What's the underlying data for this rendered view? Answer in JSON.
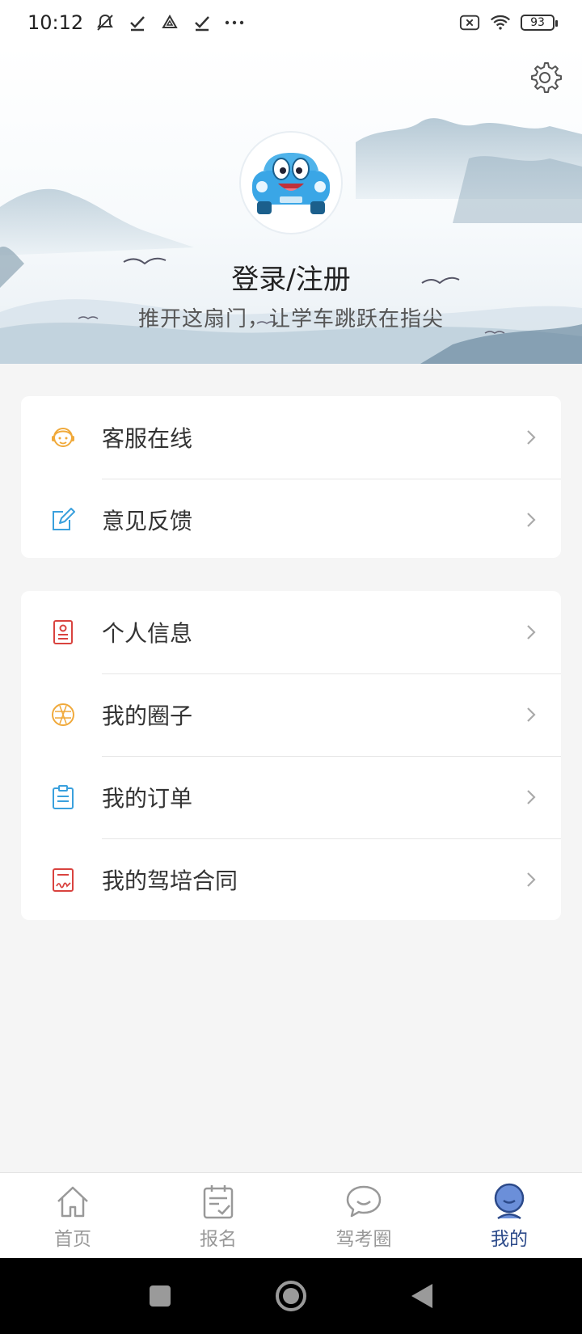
{
  "status_bar": {
    "time": "10:12",
    "battery": "93",
    "icons": [
      "muted-notification-icon",
      "check-icon",
      "drive-icon",
      "check-icon",
      "more-dots-icon",
      "sim-off-icon",
      "wifi-icon",
      "battery-icon"
    ]
  },
  "header": {
    "login_title": "登录/注册",
    "slogan": "推开这扇门，让学车跳跃在指尖",
    "settings_icon": "gear-icon",
    "avatar_icon": "car-mascot-avatar"
  },
  "menu_group_1": [
    {
      "label": "客服在线",
      "icon": "customer-service-icon",
      "color": "#f0a93a"
    },
    {
      "label": "意见反馈",
      "icon": "edit-feedback-icon",
      "color": "#3aa0dd"
    }
  ],
  "menu_group_2": [
    {
      "label": "个人信息",
      "icon": "profile-card-icon",
      "color": "#d9433f"
    },
    {
      "label": "我的圈子",
      "icon": "circle-icon",
      "color": "#f0a93a"
    },
    {
      "label": "我的订单",
      "icon": "clipboard-icon",
      "color": "#3aa0dd"
    },
    {
      "label": "我的驾培合同",
      "icon": "contract-icon",
      "color": "#d9433f"
    }
  ],
  "tab_bar": {
    "active_color": "#2c4a8a",
    "inactive_color": "#999999",
    "tabs": [
      {
        "label": "首页",
        "icon": "home-icon",
        "active": false
      },
      {
        "label": "报名",
        "icon": "signup-checklist-icon",
        "active": false
      },
      {
        "label": "驾考圈",
        "icon": "chat-bubble-icon",
        "active": false
      },
      {
        "label": "我的",
        "icon": "user-face-icon",
        "active": true
      }
    ]
  },
  "nav_bar": {
    "buttons": [
      "recents-square-icon",
      "home-circle-icon",
      "back-triangle-icon"
    ]
  }
}
